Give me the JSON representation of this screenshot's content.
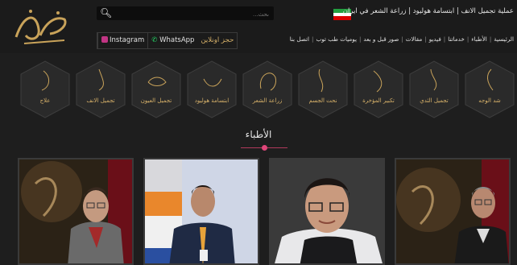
{
  "header": {
    "title": "عملیة تجمیل الانف | ابتسامة هولیود | زراعة الشعر في ایران",
    "search_placeholder": "ىحث..."
  },
  "social": {
    "instagram": "Instagram",
    "whatsapp": "WhatsApp",
    "book": "حجز اونلاین"
  },
  "nav": [
    "الرئيسية",
    "الأطباء",
    "خدماتنا",
    "فيديو",
    "مقالات",
    "صور قبل و بعد",
    "يوميات طب توب",
    "اتصل بنا"
  ],
  "categories": [
    "علاج",
    "تجميل الانف",
    "تجميل العيون",
    "ابتسامة هوليود",
    "زراعة الشعر",
    "نحت الجسم",
    "تكبير المؤخرة",
    "تجميل الثدي",
    "شد الوجه"
  ],
  "section": {
    "title": "الأطباء"
  },
  "colors": {
    "accent": "#d8b26a",
    "pink": "#e0467a",
    "bg": "#1e1e1e"
  }
}
